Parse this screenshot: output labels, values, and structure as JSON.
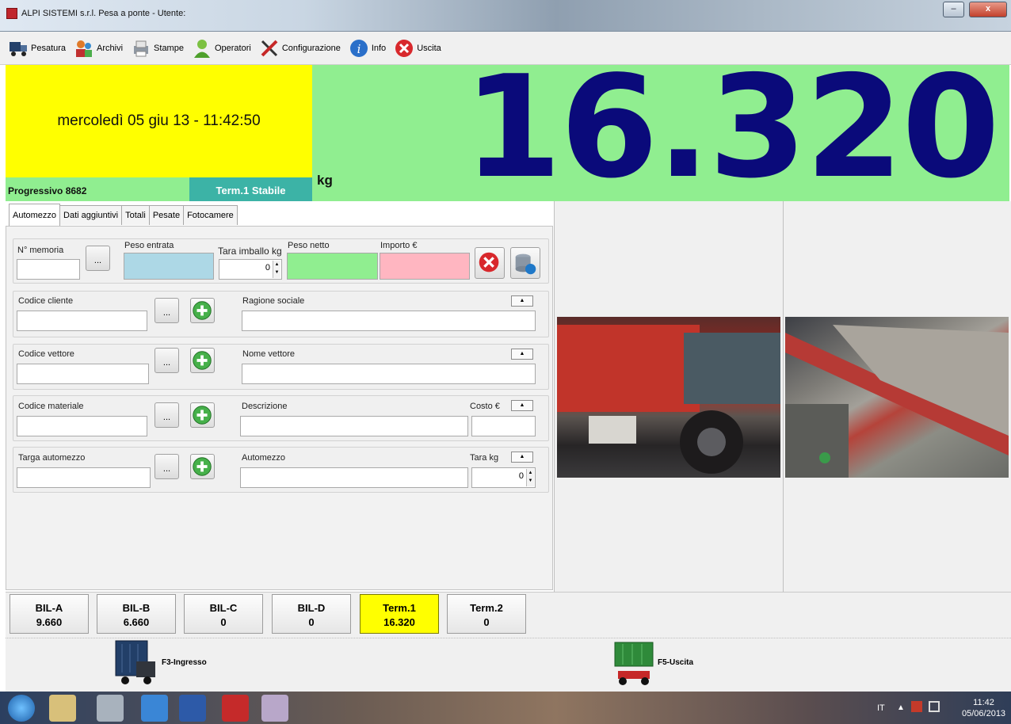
{
  "window": {
    "title": "ALPI SISTEMI s.r.l. Pesa a ponte - Utente:",
    "minimize": "–",
    "maximize": "□",
    "close": "x"
  },
  "toolbar": [
    {
      "label": "Pesatura",
      "icon": "truck-icon"
    },
    {
      "label": "Archivi",
      "icon": "archive-people-icon"
    },
    {
      "label": "Stampe",
      "icon": "printer-icon"
    },
    {
      "label": "Operatori",
      "icon": "user-icon"
    },
    {
      "label": "Configurazione",
      "icon": "tools-icon"
    },
    {
      "label": "Info",
      "icon": "info-icon"
    },
    {
      "label": "Uscita",
      "icon": "exit-icon"
    }
  ],
  "header": {
    "datetime": "mercoledì 05 giu 13 - 11:42:50",
    "weight": "16.320",
    "unit": "kg",
    "progressivo": "Progressivo 8682",
    "status": "Term.1 Stabile"
  },
  "tabs": [
    "Automezzo",
    "Dati aggiuntivi",
    "Totali",
    "Pesate",
    "Fotocamere"
  ],
  "form": {
    "memoria_label": "N° memoria",
    "peso_entrata_label": "Peso entrata",
    "tara_imballo_label": "Tara imballo kg",
    "tara_imballo_value": "0",
    "peso_netto_label": "Peso netto",
    "importo_label": "Importo €",
    "dots": "...",
    "codice_cliente_label": "Codice cliente",
    "ragione_sociale_label": "Ragione sociale",
    "codice_vettore_label": "Codice vettore",
    "nome_vettore_label": "Nome vettore",
    "codice_materiale_label": "Codice materiale",
    "descrizione_label": "Descrizione",
    "costo_label": "Costo €",
    "targa_label": "Targa automezzo",
    "automezzo_label": "Automezzo",
    "tara_kg_label": "Tara kg",
    "tara_kg_value": "0"
  },
  "scales": [
    {
      "name": "BIL-A",
      "value": "9.660"
    },
    {
      "name": "BIL-B",
      "value": "6.660"
    },
    {
      "name": "BIL-C",
      "value": "0"
    },
    {
      "name": "BIL-D",
      "value": "0"
    },
    {
      "name": "Term.1",
      "value": "16.320"
    },
    {
      "name": "Term.2",
      "value": "0"
    }
  ],
  "actions": {
    "ingresso": "F3-Ingresso",
    "uscita": "F5-Uscita"
  },
  "tray": {
    "lang": "IT",
    "time": "11:42",
    "date": "05/06/2013"
  },
  "colors": {
    "weight": "#0a0a7a",
    "weight_bg": "#90ee90",
    "date_bg": "#ffff00",
    "status_bg": "#3cb3a6",
    "peso_entrata": "#add8e6",
    "peso_netto": "#90ee90",
    "importo": "#ffb6c1"
  }
}
